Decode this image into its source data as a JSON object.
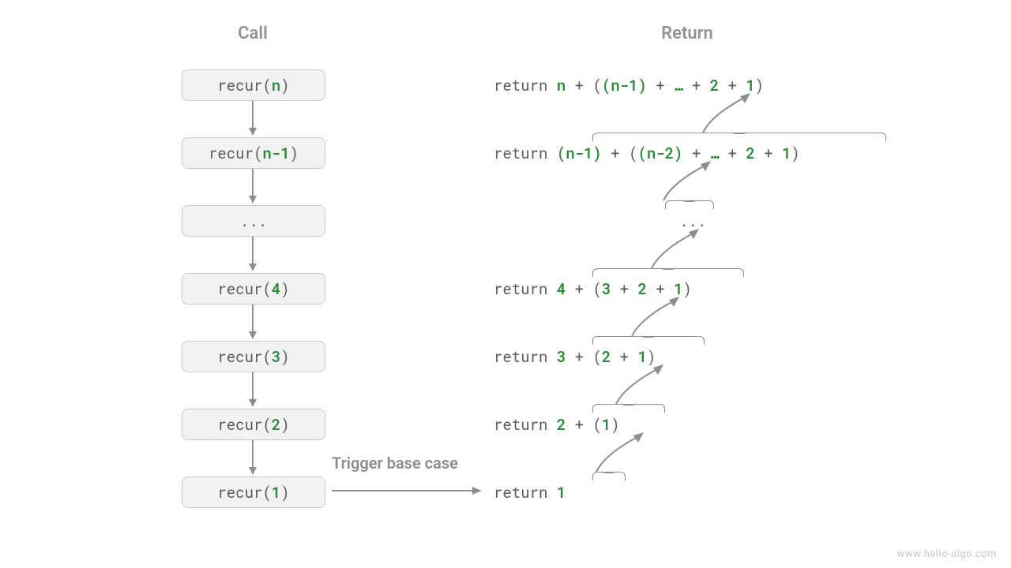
{
  "headers": {
    "call": "Call",
    "return": "Return"
  },
  "calls": [
    {
      "prefix": "recur(",
      "arg": "n",
      "suffix": ")"
    },
    {
      "prefix": "recur(",
      "arg": "n-1",
      "suffix": ")"
    },
    {
      "prefix": "",
      "arg": "",
      "suffix": "...",
      "plain": true
    },
    {
      "prefix": "recur(",
      "arg": "4",
      "suffix": ")"
    },
    {
      "prefix": "recur(",
      "arg": "3",
      "suffix": ")"
    },
    {
      "prefix": "recur(",
      "arg": "2",
      "suffix": ")"
    },
    {
      "prefix": "recur(",
      "arg": "1",
      "suffix": ")"
    }
  ],
  "returns": {
    "r0": {
      "kw": "return ",
      "a": "n",
      "plus": " + (",
      "b": "(n-1)",
      "mid": " + ",
      "dots": "…",
      "mid2": " + ",
      "c": "2",
      "mid3": " + ",
      "d": "1",
      "close": ")"
    },
    "r1": {
      "kw": "return ",
      "a": "(n-1)",
      "plus": " + (",
      "b": "(n-2)",
      "mid": " + ",
      "dots": "…",
      "mid2": " + ",
      "c": "2",
      "mid3": " + ",
      "d": "1",
      "close": ")"
    },
    "r2": {
      "text": "..."
    },
    "r3": {
      "kw": "return ",
      "a": "4",
      "plus": " + (",
      "b": "3",
      "mid": " + ",
      "c": "2",
      "mid2": " + ",
      "d": "1",
      "close": ")"
    },
    "r4": {
      "kw": "return ",
      "a": "3",
      "plus": " + (",
      "b": "2",
      "mid": " + ",
      "c": "1",
      "close": ")"
    },
    "r5": {
      "kw": "return ",
      "a": "2",
      "plus": " + (",
      "b": "1",
      "close": ")"
    },
    "r6": {
      "kw": "return ",
      "a": "1"
    }
  },
  "base_case_label": "Trigger base case",
  "watermark": "www.hello-algo.com",
  "colors": {
    "accent": "#2d8a3c",
    "muted": "#8e8e8e",
    "box_bg": "#f2f2f2",
    "box_border": "#c9c9c9"
  }
}
